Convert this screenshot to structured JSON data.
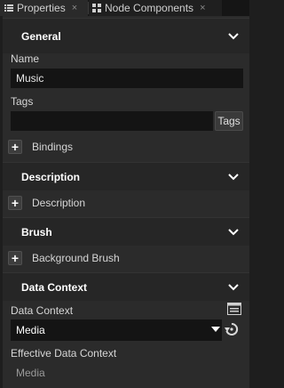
{
  "tabs": [
    {
      "label": "Properties",
      "icon": "list-icon",
      "close": "×"
    },
    {
      "label": "Node Components",
      "icon": "grid-icon",
      "close": "×"
    }
  ],
  "general": {
    "title": "General",
    "name_label": "Name",
    "name_value": "Music",
    "tags_label": "Tags",
    "tags_value": "",
    "tags_button": "Tags",
    "bindings_label": "Bindings"
  },
  "description": {
    "title": "Description",
    "add_label": "Description"
  },
  "brush": {
    "title": "Brush",
    "add_label": "Background Brush"
  },
  "data_context": {
    "title": "Data Context",
    "field_label": "Data Context",
    "selected": "Media",
    "effective_label": "Effective Data Context",
    "effective_value": "Media"
  },
  "colors": {
    "background": "#2b2b2b",
    "header": "#262626",
    "field": "#141414",
    "text": "#d9d9d9"
  }
}
